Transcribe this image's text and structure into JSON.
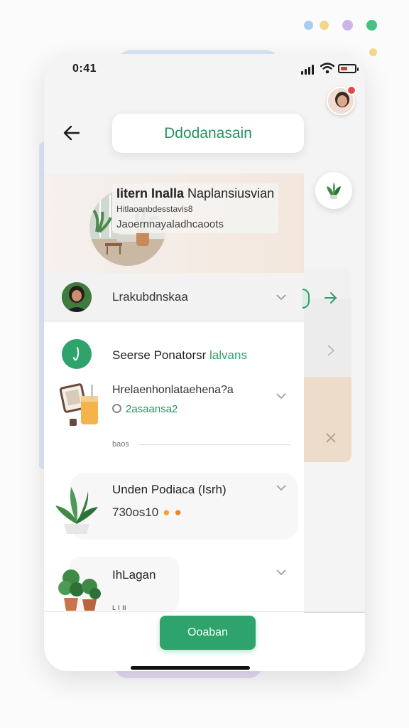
{
  "colors": {
    "accent": "#2fa36c",
    "notification": "#e54848"
  },
  "decor_dots": [
    "#a9cdee",
    "#f2d68a",
    "#c9b5ea",
    "#45c283",
    "#f2d68a"
  ],
  "status_bar": {
    "time": "0:41"
  },
  "header": {
    "title": "Ddodanasain"
  },
  "hero": {
    "title_bold": "Iitern Inalla",
    "title_rest": " Naplansiusvian",
    "subtitle": "Hitlaoanbdesstavis8",
    "tagline": "Jaoernnayaladhcaoots"
  },
  "user": {
    "name": "Lrakubdnskaa"
  },
  "sections": {
    "stage_title_main": "Seerse Ponatorsr",
    "stage_title_accent": "lalvans",
    "item1_title": "Hrelaenhonlataehena?a",
    "item1_meta": "2asaansa2",
    "divider_label": "baos",
    "item2_title": "Unden Podiaca (Isrh)",
    "item2_meta": "730os10",
    "item3_title": "IhLagan",
    "item3_partial": "ʟ ι ιι"
  },
  "actions": {
    "cta_label": "Ooaban"
  },
  "icons": {
    "back": "arrow-left-icon",
    "chevron": "chevron-down-icon",
    "plant_button": "plant-icon",
    "stage": "sprout-icon"
  }
}
